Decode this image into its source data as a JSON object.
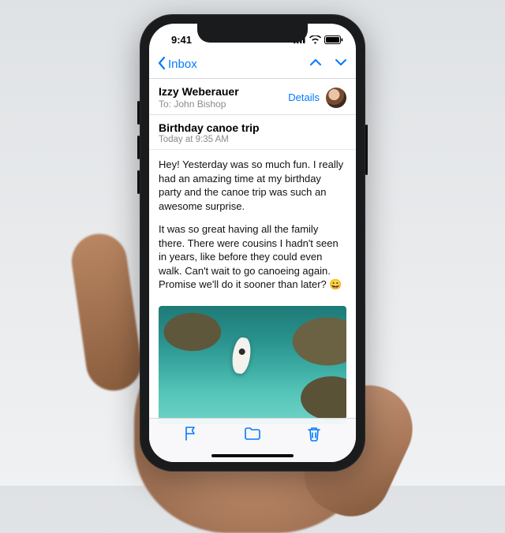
{
  "status": {
    "time": "9:41"
  },
  "nav": {
    "back_label": "Inbox"
  },
  "header": {
    "from": "Izzy Weberauer",
    "to_label": "To:",
    "to_name": "John Bishop",
    "details": "Details"
  },
  "subject": {
    "title": "Birthday canoe trip",
    "date": "Today at 9:35 AM"
  },
  "body": {
    "p1": "Hey! Yesterday was so much fun. I really had an amazing time at my birthday party and the canoe trip was such an awesome surprise.",
    "p2": "It was so great having all the family there. There were cousins I hadn't seen in years, like before they could even walk. Can't wait to go canoeing again. Promise we'll do it sooner than later? 😀"
  },
  "icons": {
    "signal": "signal-icon",
    "wifi": "wifi-icon",
    "battery": "battery-icon",
    "chevron_left": "chevron-left-icon",
    "chevron_up": "chevron-up-icon",
    "chevron_down": "chevron-down-icon",
    "flag": "flag-icon",
    "folder": "folder-icon",
    "trash": "trash-icon"
  },
  "colors": {
    "accent": "#007aff"
  }
}
